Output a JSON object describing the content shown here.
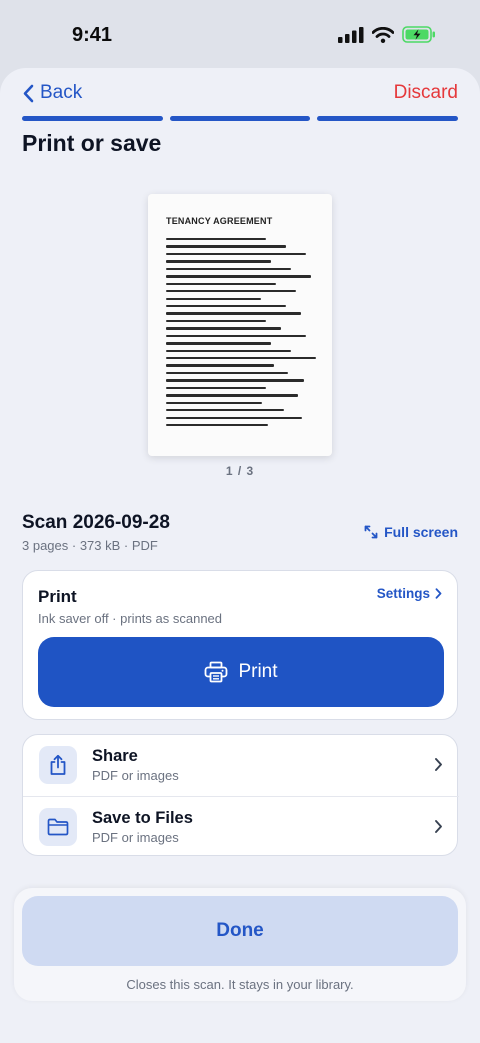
{
  "status_bar": {
    "time": "9:41"
  },
  "nav": {
    "back_label": "Back",
    "discard_label": "Discard",
    "steps_total": 3,
    "steps_completed": 3
  },
  "page_title": "Print or save",
  "preview": {
    "doc_heading": "TENANCY AGREEMENT",
    "page_indicator": "1 / 3"
  },
  "scan": {
    "name": "Scan 2026-09-28",
    "meta": "3 pages · 373 kB · PDF",
    "fullscreen_label": "Full screen"
  },
  "print_card": {
    "title": "Print",
    "subtitle": "Ink saver off · prints as scanned",
    "settings_label": "Settings",
    "print_button_label": "Print"
  },
  "actions": [
    {
      "title": "Share",
      "subtitle": "PDF or images",
      "icon": "share-icon"
    },
    {
      "title": "Save to Files",
      "subtitle": "PDF or images",
      "icon": "folder-icon"
    }
  ],
  "footer": {
    "done_label": "Done",
    "note": "Closes this scan. It stays in your library."
  },
  "colors": {
    "accent": "#2456c6",
    "destructive": "#e5383b",
    "battery": "#4cd964"
  }
}
